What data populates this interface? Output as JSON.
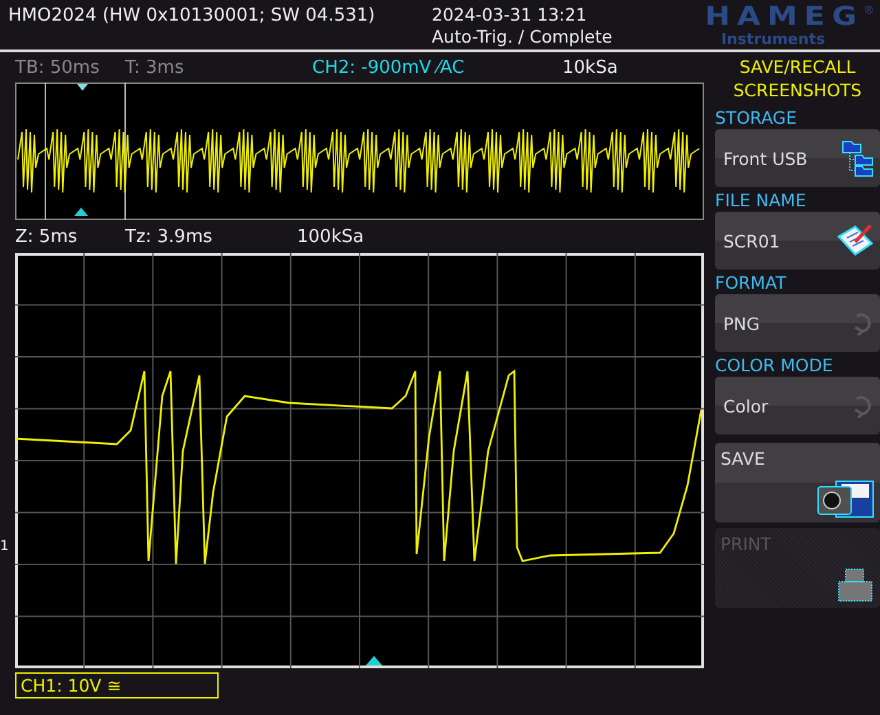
{
  "header": {
    "title": "HMO2024 (HW 0x10130001; SW 04.531)",
    "datetime": "2024-03-31 13:21",
    "trigger_status": "Auto-Trig. / Complete",
    "logo": "HAMEG",
    "logo_mark": "®",
    "logo_sub": "Instruments"
  },
  "overview": {
    "timebase": "TB: 50ms",
    "trigger_time": "T: 3ms",
    "channel_info": "CH2: -900mV ⁄AC",
    "sample_rate": "10kSa"
  },
  "zoom": {
    "timebase": "Z: 5ms",
    "trigger_time": "Tz: 3.9ms",
    "sample_rate": "100kSa"
  },
  "channel_label": "CH1: 10V ≅",
  "channel_marker": "1",
  "menu": {
    "title": "SAVE/RECALL",
    "subtitle": "SCREENSHOTS",
    "settings": [
      {
        "label": "STORAGE",
        "value": "Front USB",
        "kind": "folders"
      },
      {
        "label": "FILE NAME",
        "value": "SCR01",
        "kind": "notepad"
      },
      {
        "label": "FORMAT",
        "value": "PNG",
        "kind": "cycle"
      },
      {
        "label": "COLOR MODE",
        "value": "Color",
        "kind": "cycle"
      }
    ],
    "actions": [
      {
        "label": "SAVE",
        "kind": "camera",
        "disabled": false
      },
      {
        "label": "PRINT",
        "kind": "printer",
        "disabled": true
      }
    ]
  }
}
